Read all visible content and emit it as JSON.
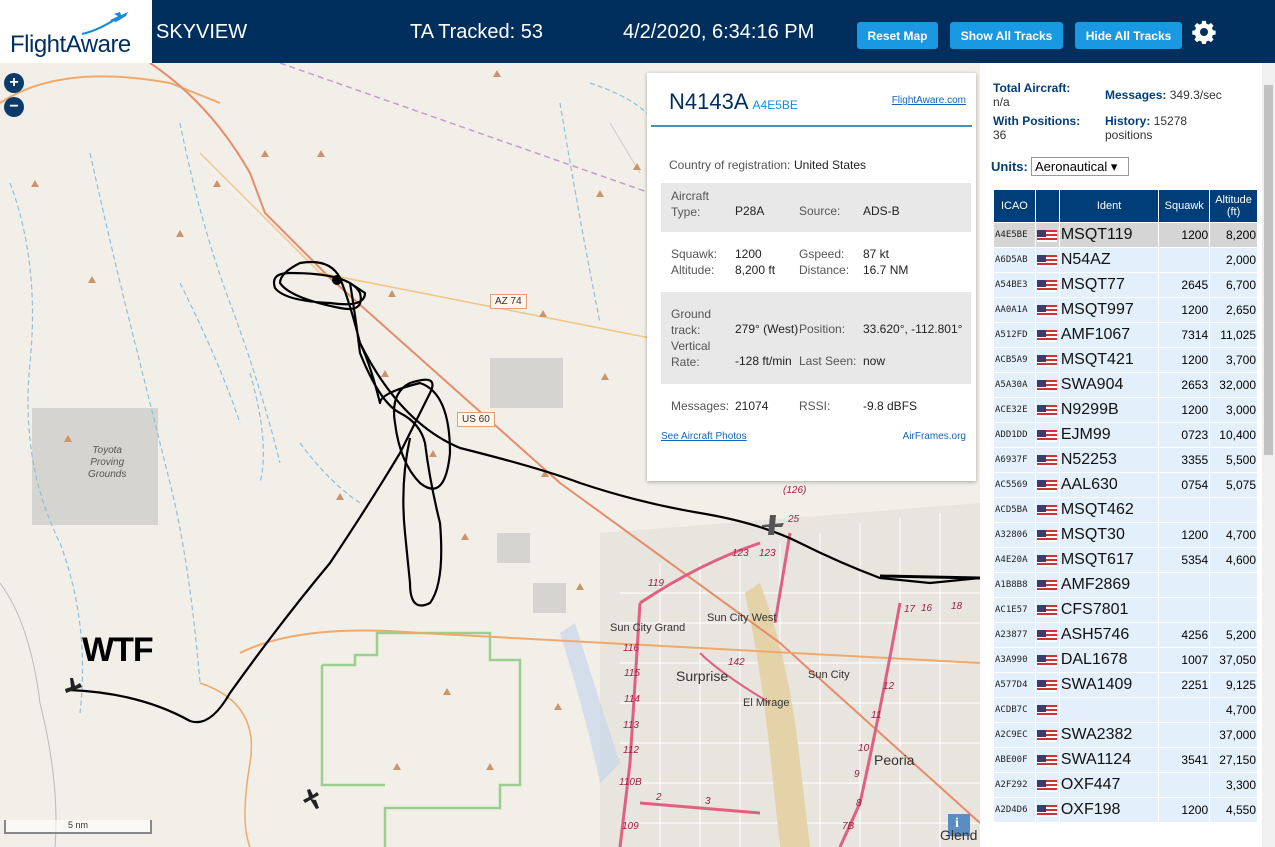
{
  "header": {
    "logo": "FlightAware",
    "app_name": "SKYVIEW",
    "ta_tracked": "TA Tracked: 53",
    "datetime": "4/2/2020, 6:34:16 PM",
    "buttons": [
      "Reset Map",
      "Show All Tracks",
      "Hide All Tracks"
    ],
    "settings_icon": "gear-icon"
  },
  "map": {
    "zoom_in": "+",
    "zoom_out": "−",
    "scale": "5 nm",
    "annotation": "WTF",
    "labels": {
      "az74": "AZ 74",
      "us60": "US 60",
      "proving": "Toyota\nProving\nGrounds",
      "sun_city_grand": "Sun City Grand",
      "sun_city_west": "Sun City West",
      "surprise": "Surprise",
      "sun_city": "Sun City",
      "el_mirage": "El Mirage",
      "peoria": "Peoria",
      "glendale": "Glend",
      "r126": "(126)",
      "r25": "25",
      "r123a": "123",
      "r123b": "123",
      "r119": "119",
      "r142": "142",
      "r116": "116",
      "r115": "115",
      "r114": "114",
      "r113": "113",
      "r112": "112",
      "r110b": "110B",
      "r109": "109",
      "r17": "17",
      "r16": "16",
      "r18": "18",
      "r12": "12",
      "r11": "11",
      "r10": "10",
      "r9": "9",
      "r8": "8",
      "r7b": "7B",
      "r2": "2",
      "r3": "3",
      "info": "i"
    }
  },
  "popup": {
    "registration": "N4143A",
    "icao": "A4E5BE",
    "fa_link": "FlightAware.com",
    "country_label": "Country of registration:",
    "country": "United States",
    "aircraft_type_label": "Aircraft\nType:",
    "aircraft_type": "P28A",
    "source_label": "Source:",
    "source": "ADS-B",
    "squawk_label": "Squawk:",
    "squawk": "1200",
    "gspeed_label": "Gspeed:",
    "gspeed": "87 kt",
    "altitude_label": "Altitude:",
    "altitude": "8,200 ft",
    "distance_label": "Distance:",
    "distance": "16.7 NM",
    "track_label": "Ground\ntrack:",
    "track": "279° (West)",
    "position_label": "Position:",
    "position": "33.620°, -112.801°",
    "vrate_label": "Vertical\nRate:",
    "vrate": "-128 ft/min",
    "last_seen_label": "Last Seen:",
    "last_seen": "now",
    "messages_label": "Messages:",
    "messages": "21074",
    "rssi_label": "RSSI:",
    "rssi": "-9.8 dBFS",
    "photos_link": "See Aircraft Photos",
    "airframes_link": "AirFrames.org"
  },
  "sidebar": {
    "total_aircraft_label": "Total Aircraft:",
    "total_aircraft": "n/a",
    "messages_label": "Messages:",
    "messages": "349.3/sec",
    "with_positions_label": "With Positions:",
    "with_positions": "36",
    "history_label": "History:",
    "history": "15278\npositions",
    "units_label": "Units:",
    "units_value": "Aeronautical ▾",
    "columns": [
      "ICAO",
      "",
      "Ident",
      "Squawk",
      "Altitude\n(ft)"
    ],
    "rows": [
      {
        "icao": "A4E5BE",
        "ident": "MSQT119",
        "squawk": "1200",
        "alt": "8,200"
      },
      {
        "icao": "A6D5AB",
        "ident": "N54AZ",
        "squawk": "",
        "alt": "2,000"
      },
      {
        "icao": "A54BE3",
        "ident": "MSQT77",
        "squawk": "2645",
        "alt": "6,700"
      },
      {
        "icao": "AA0A1A",
        "ident": "MSQT997",
        "squawk": "1200",
        "alt": "2,650"
      },
      {
        "icao": "A512FD",
        "ident": "AMF1067",
        "squawk": "7314",
        "alt": "11,025"
      },
      {
        "icao": "ACB5A9",
        "ident": "MSQT421",
        "squawk": "1200",
        "alt": "3,700"
      },
      {
        "icao": "A5A30A",
        "ident": "SWA904",
        "squawk": "2653",
        "alt": "32,000"
      },
      {
        "icao": "ACE32E",
        "ident": "N9299B",
        "squawk": "1200",
        "alt": "3,000"
      },
      {
        "icao": "ADD1DD",
        "ident": "EJM99",
        "squawk": "0723",
        "alt": "10,400"
      },
      {
        "icao": "A6937F",
        "ident": "N52253",
        "squawk": "3355",
        "alt": "5,500"
      },
      {
        "icao": "AC5569",
        "ident": "AAL630",
        "squawk": "0754",
        "alt": "5,075"
      },
      {
        "icao": "ACD5BA",
        "ident": "MSQT462",
        "squawk": "",
        "alt": ""
      },
      {
        "icao": "A32806",
        "ident": "MSQT30",
        "squawk": "1200",
        "alt": "4,700"
      },
      {
        "icao": "A4E20A",
        "ident": "MSQT617",
        "squawk": "5354",
        "alt": "4,600"
      },
      {
        "icao": "A1B8B8",
        "ident": "AMF2869",
        "squawk": "",
        "alt": ""
      },
      {
        "icao": "AC1E57",
        "ident": "CFS7801",
        "squawk": "",
        "alt": ""
      },
      {
        "icao": "A23877",
        "ident": "ASH5746",
        "squawk": "4256",
        "alt": "5,200"
      },
      {
        "icao": "A3A990",
        "ident": "DAL1678",
        "squawk": "1007",
        "alt": "37,050"
      },
      {
        "icao": "A577D4",
        "ident": "SWA1409",
        "squawk": "2251",
        "alt": "9,125"
      },
      {
        "icao": "ACDB7C",
        "ident": "",
        "squawk": "",
        "alt": "4,700"
      },
      {
        "icao": "A2C9EC",
        "ident": "SWA2382",
        "squawk": "",
        "alt": "37,000"
      },
      {
        "icao": "ABE00F",
        "ident": "SWA1124",
        "squawk": "3541",
        "alt": "27,150"
      },
      {
        "icao": "A2F292",
        "ident": "OXF447",
        "squawk": "",
        "alt": "3,300"
      },
      {
        "icao": "A2D4D6",
        "ident": "OXF198",
        "squawk": "1200",
        "alt": "4,550"
      }
    ]
  },
  "colors": {
    "header_bg": "#002f5d",
    "button_bg": "#1a98e2",
    "table_header": "#003e7a",
    "row_bg": "#e3f0fb",
    "selected_row": "#d5d5d5",
    "track": "#000000"
  }
}
